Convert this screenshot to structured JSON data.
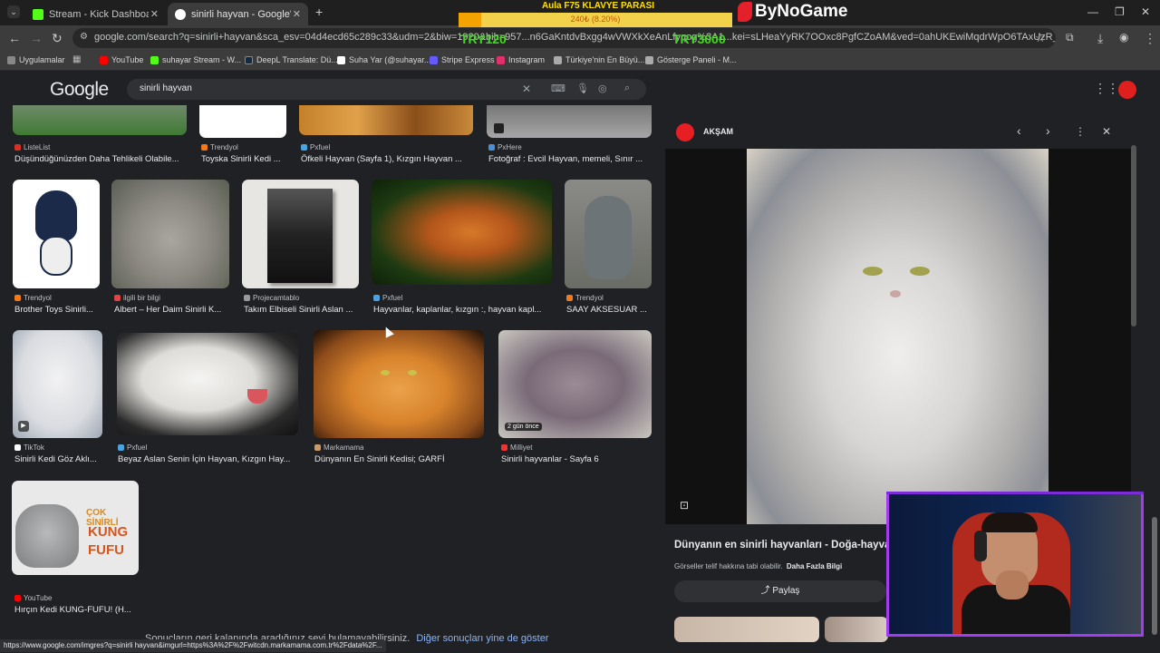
{
  "tabs": [
    {
      "title": "Stream - Kick Dashboard",
      "favicon_color": "#53fc18"
    },
    {
      "title": "sinirli hayvan - Google'da Ara",
      "favicon_color": "#4285f4"
    }
  ],
  "address": {
    "url": "google.com/search?q=sinirli+hayvan&sca_esv=04d4ecd65c289c33&udm=2&biw=1920&bih=957...n6GaKntdvBxgg4wVWXkXeAnLfyqog%3A1...kei=sLHeaYyRK7OOxc8PgfCZoAM&ved=0ahUKEwiMqdrWpO6TAxUzR_EDHQ..."
  },
  "bookmarks": [
    {
      "label": "Uygulamalar",
      "color": "#888888"
    },
    {
      "label": "YouTube",
      "color": "#ff0000"
    },
    {
      "label": "suhayar Stream - W...",
      "color": "#53fc18"
    },
    {
      "label": "DeepL Translate: Dü...",
      "color": "#0f2b46"
    },
    {
      "label": "Suha Yar (@suhayar...",
      "color": "#ffffff"
    },
    {
      "label": "Stripe Express",
      "color": "#635bff"
    },
    {
      "label": "Instagram",
      "color": "#e1306c"
    },
    {
      "label": "Türkiye'nin En Büyü...",
      "color": "#aaaaaa"
    },
    {
      "label": "Gösterge Paneli - M...",
      "color": "#aaaaaa"
    }
  ],
  "overlay": {
    "title": "Aula F75 KLAVYE PARASI",
    "progress_text": "240₺ (8.20%)",
    "progress_fraction": 0.082,
    "min_label": "TRY120",
    "max_label": "TRY3000",
    "brand": "ByNoGame"
  },
  "search": {
    "logo": "Google",
    "query": "sinirli hayvan"
  },
  "results": {
    "row0": [
      {
        "source": "ListeList",
        "caption": "Düşündüğünüzden Daha Tehlikeli Olabile...",
        "dot": "#d93025"
      },
      {
        "source": "Trendyol",
        "caption": "Toyska Sinirli Kedi ...",
        "dot": "#f27a1a"
      },
      {
        "source": "Pxfuel",
        "caption": "Öfkeli Hayvan (Sayfa 1), Kızgın Hayvan ...",
        "dot": "#4aa3df"
      },
      {
        "source": "PxHere",
        "caption": "Fotoğraf : Evcil Hayvan, memeli, Sınır ...",
        "dot": "#4a90d9"
      }
    ],
    "row1": [
      {
        "source": "Trendyol",
        "caption": "Brother Toys Sinirli...",
        "dot": "#f27a1a"
      },
      {
        "source": "ilgili bir bilgi",
        "caption": "Albert – Her Daim Sinirli K...",
        "dot": "#d44"
      },
      {
        "source": "Projecamtablo",
        "caption": "Takım Elbiseli Sinirli Aslan ...",
        "dot": "#999"
      },
      {
        "source": "Pxfuel",
        "caption": "Hayvanlar, kaplanlar, kızgın :, hayvan kapl...",
        "dot": "#4aa3df"
      },
      {
        "source": "Trendyol",
        "caption": "SAAY AKSESUAR ...",
        "dot": "#f27a1a"
      }
    ],
    "row2": [
      {
        "source": "TikTok",
        "caption": "Sinirli Kedi Göz Aklı...",
        "dot": "#ffffff"
      },
      {
        "source": "Pxfuel",
        "caption": "Beyaz Aslan Senin İçin Hayvan, Kızgın Hay...",
        "dot": "#4aa3df"
      },
      {
        "source": "Markamama",
        "caption": "Dünyanın En Sinirli Kedisi; GARFİ",
        "dot": "#c96"
      },
      {
        "source": "Milliyet",
        "caption": "Sinirli hayvanlar - Sayfa 6",
        "dot": "#e33"
      }
    ],
    "row3": [
      {
        "source": "YouTube",
        "caption": "Hırçın Kedi KUNG-FUFU! (H...",
        "dot": "#ff0000"
      }
    ],
    "thumb_overlay_text": "2 gün önce",
    "kung_fufu_text": [
      "ÇOK SİNİRLİ",
      "KUNG",
      "FUFU"
    ],
    "footer_text": "Sonuçların geri kalanında aradığınız şeyi bulamayabilirsiniz.",
    "footer_link": "Diğer sonuçları yine de göster"
  },
  "preview": {
    "source": "AKŞAM",
    "title": "Dünyanın en sinirli hayvanları - Doğa-hayva...",
    "copyright": "Görseller telif hakkına tabi olabilir.",
    "more_info": "Daha Fazla Bilgi",
    "share": "Paylaş"
  },
  "status_bar": "https://www.google.com/imgres?q=sinirli hayvan&imgurl=https%3A%2F%2Fwitcdn.markamama.com.tr%2Fdata%2F..."
}
